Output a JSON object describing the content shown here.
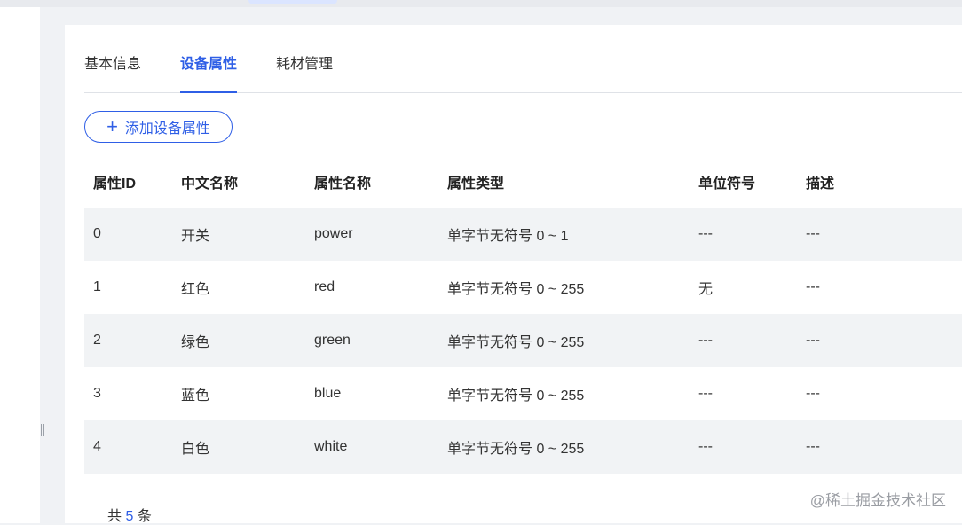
{
  "tabs": [
    {
      "label": "基本信息",
      "active": false
    },
    {
      "label": "设备属性",
      "active": true
    },
    {
      "label": "耗材管理",
      "active": false
    }
  ],
  "add_button": {
    "icon": "plus-icon",
    "label": "添加设备属性"
  },
  "table": {
    "columns": [
      "属性ID",
      "中文名称",
      "属性名称",
      "属性类型",
      "单位符号",
      "描述"
    ],
    "rows": [
      [
        "0",
        "开关",
        "power",
        "单字节无符号 0 ~ 1",
        "---",
        "---"
      ],
      [
        "1",
        "红色",
        "red",
        "单字节无符号 0 ~ 255",
        "无",
        "---"
      ],
      [
        "2",
        "绿色",
        "green",
        "单字节无符号 0 ~ 255",
        "---",
        "---"
      ],
      [
        "3",
        "蓝色",
        "blue",
        "单字节无符号 0 ~ 255",
        "---",
        "---"
      ],
      [
        "4",
        "白色",
        "white",
        "单字节无符号 0 ~ 255",
        "---",
        "---"
      ]
    ]
  },
  "footer": {
    "prefix": "共",
    "count": "5",
    "suffix": "条"
  },
  "watermark": "@稀土掘金技术社区",
  "colors": {
    "accent": "#2f5fe6",
    "row_stripe": "#f1f3f5",
    "background": "#f0f2f5"
  }
}
